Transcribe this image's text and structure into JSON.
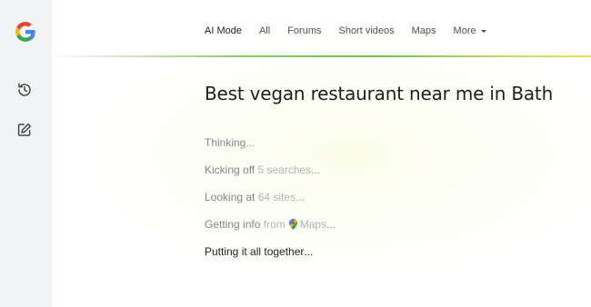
{
  "nav": {
    "logo_icon": "google-g-logo",
    "history_icon": "history-icon",
    "new_chat_icon": "edit-icon"
  },
  "tabs": [
    {
      "label": "AI Mode",
      "active": true
    },
    {
      "label": "All",
      "active": false
    },
    {
      "label": "Forums",
      "active": false
    },
    {
      "label": "Short videos",
      "active": false
    },
    {
      "label": "Maps",
      "active": false
    },
    {
      "label": "More",
      "active": false
    }
  ],
  "query": "Best vegan restaurant near me in Bath",
  "steps": {
    "thinking": {
      "strong": "Thinking",
      "dots": "..."
    },
    "kicking_off": {
      "strong": "Kicking off",
      "light": "5 searches",
      "dots": "..."
    },
    "looking_at": {
      "strong": "Looking at",
      "light": "64 sites",
      "dots": "..."
    },
    "getting_info": {
      "strong": "Getting info",
      "light": "from",
      "source": "Maps",
      "dots": "..."
    },
    "putting_together": {
      "strong": "Putting it all together",
      "dots": "..."
    }
  },
  "colors": {
    "rail_bg": "#f3f4f6",
    "accent_line": "#6fbf55",
    "muted_text": "#9aa0a6"
  }
}
